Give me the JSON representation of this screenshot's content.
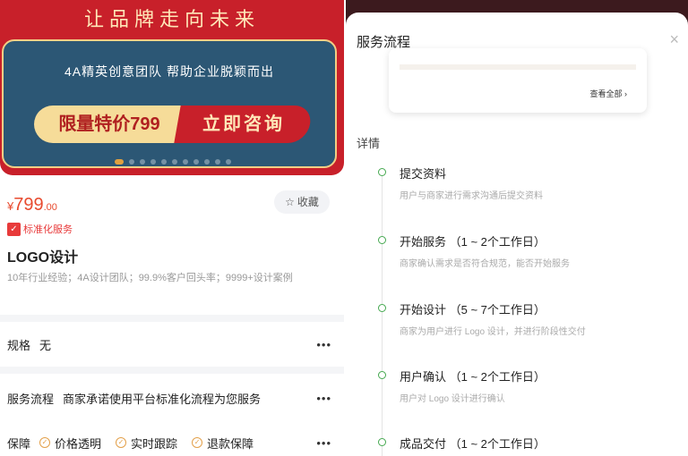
{
  "banner": {
    "title": "让品牌走向未来",
    "subtitle": "4A精英创意团队  帮助企业脱颖而出",
    "promo_price": "限量特价799",
    "promo_action": "立即咨询"
  },
  "product": {
    "currency": "¥",
    "price_int": "799",
    "price_dec": ".00",
    "favorite_label": "收藏",
    "badge": "标准化服务",
    "title": "LOGO设计",
    "description": "10年行业经验；4A设计团队；99.9%客户回头率；9999+设计案例"
  },
  "rows": {
    "spec_label": "规格",
    "spec_value": "无",
    "process_label": "服务流程",
    "process_value": "商家承诺使用平台标准化流程为您服务",
    "guarantee_label": "保障",
    "guarantees": [
      "价格透明",
      "实时跟踪",
      "退款保障"
    ],
    "more": "•••"
  },
  "sheet": {
    "title": "服务流程",
    "close": "×",
    "card_more": "查看全部 ›",
    "detail_heading": "详情",
    "steps": [
      {
        "title": "提交资料",
        "desc": "用户与商家进行需求沟通后提交资料"
      },
      {
        "title": "开始服务 （1 ~ 2个工作日）",
        "desc": "商家确认需求是否符合规范，能否开始服务"
      },
      {
        "title": "开始设计 （5 ~ 7个工作日）",
        "desc": "商家为用户进行 Logo 设计，并进行阶段性交付"
      },
      {
        "title": "用户确认 （1 ~ 2个工作日）",
        "desc": "用户对 Logo 设计进行确认"
      },
      {
        "title": "成品交付 （1 ~ 2个工作日）",
        "desc": ""
      }
    ]
  },
  "colors": {
    "brand_red": "#c8202a",
    "banner_blue": "#2c5775",
    "price_orange": "#e84a2e",
    "timeline_green": "#44a84f"
  }
}
